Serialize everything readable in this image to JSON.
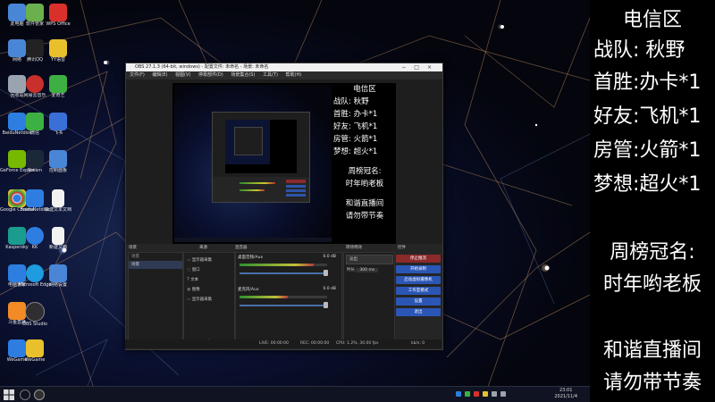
{
  "desktop": {
    "icons": [
      {
        "label": "此电脑",
        "color": "#4a86d6"
      },
      {
        "label": "软件管家",
        "color": "#6ab04c"
      },
      {
        "label": "WPS Office",
        "color": "#d9302b"
      },
      {
        "label": "网络",
        "color": "#4a86d6"
      },
      {
        "label": "腾讯QQ",
        "color": "#222222"
      },
      {
        "label": "YY语音",
        "color": "#e8c02c"
      },
      {
        "label": "回收站",
        "color": "#9aa4b1"
      },
      {
        "label": "网易云音乐",
        "color": "#c9302b"
      },
      {
        "label": "爱奇艺",
        "color": "#3cb043"
      },
      {
        "label": "BaiduNetdisk",
        "color": "#2d7ee0"
      },
      {
        "label": "微信",
        "color": "#3cb043"
      },
      {
        "label": "飞书",
        "color": "#3a6fd8"
      },
      {
        "label": "GeForce Experience",
        "color": "#76b900"
      },
      {
        "label": "Steam",
        "color": "#1b2838"
      },
      {
        "label": "控制面板",
        "color": "#4a86d6"
      },
      {
        "label": "Google Chrome",
        "color": "#e8e8e8"
      },
      {
        "label": "BaiduNetdisk",
        "color": "#2d7ee0"
      },
      {
        "label": "新建文本文档",
        "color": "#f2f2f2"
      },
      {
        "label": "Kaspersky",
        "color": "#1b9c8e"
      },
      {
        "label": "KK",
        "color": "#2d7ee0"
      },
      {
        "label": "新建文档",
        "color": "#f2f2f2"
      },
      {
        "label": "电脑管家",
        "color": "#2d7ee0"
      },
      {
        "label": "Microsoft Edge",
        "color": "#1f9be0"
      },
      {
        "label": "网络设置",
        "color": "#4a86d6"
      },
      {
        "label": "斗鱼直播",
        "color": "#f28b25"
      },
      {
        "label": "OBS Studio",
        "color": "#302e31"
      },
      {
        "label": "迅雷",
        "color": "#2d7ee0"
      },
      {
        "label": "WeGame",
        "color": "#e8c02c"
      }
    ],
    "taskbar": {
      "start_icon": "windows-start-icon",
      "apps": [
        "search-icon",
        "obs-icon"
      ],
      "tray_colors": [
        "#2d7ee0",
        "#3cb043",
        "#d9302b",
        "#e8c02c",
        "#9aa4b1"
      ],
      "time": "23:01",
      "date": "2021/11/4"
    }
  },
  "obs": {
    "title": "OBS 27.1.3 (64-bit, windows) - 配置文件: 未命名 - 场景: 未命名",
    "menu": [
      "文件(F)",
      "编辑(E)",
      "视图(V)",
      "停靠部件(D)",
      "场景集合(S)",
      "工具(T)",
      "帮助(H)"
    ],
    "docks": {
      "scenes_header": "场景",
      "scenes_title": "场景",
      "scenes": [
        "场景"
      ],
      "sources_header": "来源",
      "sources": [
        "显示器采集",
        "窗口",
        "文本",
        "图像",
        "显示器采集"
      ],
      "mixer_header": "混音器",
      "tracks": [
        {
          "name": "桌面音频/Aux",
          "db": "0.0 dB",
          "level": 0.85
        },
        {
          "name": "麦克风/Aux",
          "db": "0.0 dB",
          "level": 0.55
        }
      ],
      "transitions_header": "转场特效",
      "transition": "淡出",
      "duration_label": "时长",
      "duration": "300 ms",
      "controls_header": "控件",
      "controls": [
        "停止推流",
        "开始录制",
        "启动虚拟摄像机",
        "工作室模式",
        "设置",
        "退出"
      ]
    },
    "status": {
      "live": "LIVE: 00:00:00",
      "rec": "REC: 00:00:00",
      "cpu": "CPU: 1.2%, 30.00 fps",
      "kb": "kb/s: 0"
    }
  },
  "preview_text": {
    "line1": "电信区",
    "line2": "战队: 秋野",
    "line3": "首胜: 办卡*1",
    "line4": "好友: 飞机*1",
    "line5": "房管: 火箭*1",
    "line6": "梦想: 超火*1",
    "line7": "周榜冠名:",
    "line8": "时年哟老板",
    "line9": "和谐直播间",
    "line10": "请勿带节奏"
  },
  "overlay": {
    "line1": "电信区",
    "line2": "战队:   秋野",
    "line3": "首胜:办卡*1",
    "line4": "好友:飞机*1",
    "line5": "房管:火箭*1",
    "line6": "梦想:超火*1",
    "line7": "周榜冠名:",
    "line8": "时年哟老板",
    "line9": "和谐直播间",
    "line10": "请勿带节奏"
  }
}
